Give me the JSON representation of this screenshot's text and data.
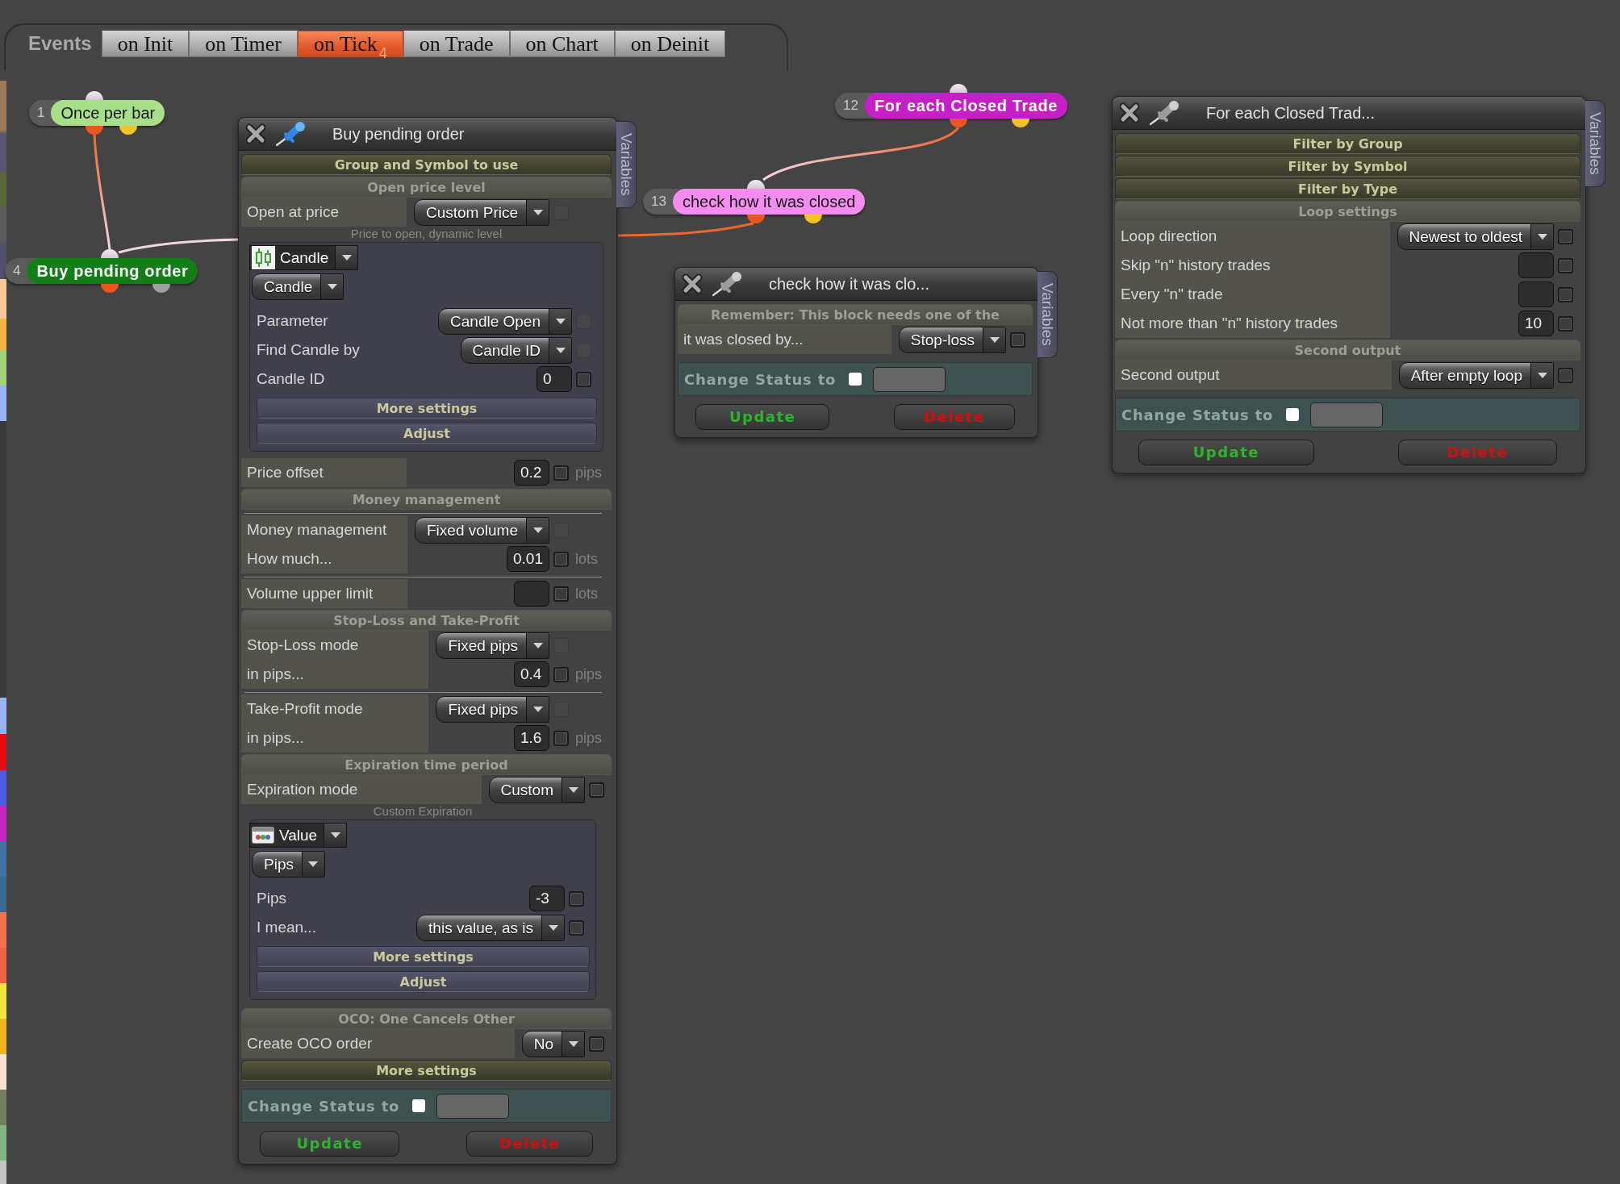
{
  "events_bar": {
    "label": "Events",
    "tabs": [
      {
        "label": "on Init",
        "selected": false
      },
      {
        "label": "on Timer",
        "selected": false
      },
      {
        "label": "on Tick",
        "selected": true,
        "count": "4"
      },
      {
        "label": "on Trade",
        "selected": false
      },
      {
        "label": "on Chart",
        "selected": false
      },
      {
        "label": "on Deinit",
        "selected": false
      }
    ]
  },
  "nodes": [
    {
      "number": "1",
      "label": "Once per bar",
      "color": "#a8df8a",
      "outputs": [
        {
          "color": "#ea561f"
        },
        {
          "color": "#f1c22c"
        }
      ]
    },
    {
      "number": "4",
      "label": "Buy pending order",
      "color": "#117e17",
      "outputs": [
        {
          "color": "#ea561f"
        },
        {
          "color": "#a0a0a0"
        }
      ]
    },
    {
      "number": "12",
      "label": "For each Closed Trade",
      "color": "#c81ec8",
      "outputs": [
        {
          "color": "#ea561f"
        },
        {
          "color": "#f1c22c"
        }
      ]
    },
    {
      "number": "13",
      "label": "check how it was closed",
      "color": "#f58df0",
      "outputs": [
        {
          "color": "#ea561f"
        },
        {
          "color": "#f1c22c"
        }
      ]
    }
  ],
  "panels": [
    {
      "title": "Buy pending order",
      "pinned": true,
      "side_tab": "Variables",
      "items": [
        {
          "kind": "section",
          "title": "Group and Symbol to use",
          "expanded": false
        },
        {
          "kind": "section",
          "title": "Open price level",
          "expanded": true,
          "items": [
            {
              "kind": "field",
              "label": "Open at price",
              "control": {
                "kind": "dropdown",
                "value": "Custom Price"
              },
              "checkbox": {
                "checked": false,
                "disabled": true
              }
            },
            {
              "kind": "hint",
              "text": "Price to open, dynamic level"
            },
            {
              "kind": "subpanel",
              "items": [
                {
                  "kind": "candle_source",
                  "value": "Candle"
                },
                {
                  "kind": "dropdown",
                  "value": "Candle"
                },
                {
                  "kind": "field",
                  "label": "Parameter",
                  "control": {
                    "kind": "dropdown",
                    "value": "Candle Open"
                  },
                  "checkbox": {
                    "checked": false,
                    "disabled": true
                  }
                },
                {
                  "kind": "field",
                  "label": "Find Candle by",
                  "control": {
                    "kind": "dropdown",
                    "value": "Candle ID"
                  },
                  "checkbox": {
                    "checked": false,
                    "disabled": true
                  }
                },
                {
                  "kind": "field",
                  "label": "Candle ID",
                  "control": {
                    "kind": "input",
                    "value": "0"
                  },
                  "checkbox": {
                    "checked": false,
                    "disabled": false
                  }
                },
                {
                  "kind": "section",
                  "title": "More settings",
                  "expanded": false
                },
                {
                  "kind": "section",
                  "title": "Adjust",
                  "expanded": false
                }
              ]
            },
            {
              "kind": "field",
              "label": "Price offset",
              "control": {
                "kind": "input",
                "value": "0.2"
              },
              "checkbox": {
                "checked": false,
                "disabled": false
              },
              "unit": "pips"
            }
          ]
        },
        {
          "kind": "section",
          "title": "Money management",
          "expanded": true,
          "items": [
            {
              "kind": "divider"
            },
            {
              "kind": "field",
              "label": "Money management",
              "control": {
                "kind": "dropdown",
                "value": "Fixed volume"
              },
              "checkbox": {
                "checked": false,
                "disabled": true
              }
            },
            {
              "kind": "field",
              "label": "How much...",
              "control": {
                "kind": "input",
                "value": "0.01"
              },
              "checkbox": {
                "checked": false,
                "disabled": false
              },
              "unit": "lots"
            },
            {
              "kind": "divider"
            },
            {
              "kind": "field",
              "label": "Volume upper limit",
              "control": {
                "kind": "input"
              },
              "checkbox": {
                "checked": false,
                "disabled": false
              },
              "unit": "lots"
            }
          ]
        },
        {
          "kind": "section",
          "title": "Stop-Loss and Take-Profit",
          "expanded": true,
          "items": [
            {
              "kind": "field",
              "label": "Stop-Loss mode",
              "control": {
                "kind": "dropdown",
                "value": "Fixed pips"
              },
              "checkbox": {
                "checked": false,
                "disabled": true
              }
            },
            {
              "kind": "field",
              "label": "in pips...",
              "control": {
                "kind": "input",
                "value": "0.4"
              },
              "checkbox": {
                "checked": false,
                "disabled": false
              },
              "unit": "pips"
            },
            {
              "kind": "divider"
            },
            {
              "kind": "field",
              "label": "Take-Profit mode",
              "control": {
                "kind": "dropdown",
                "value": "Fixed pips"
              },
              "checkbox": {
                "checked": false,
                "disabled": true
              }
            },
            {
              "kind": "field",
              "label": "in pips...",
              "control": {
                "kind": "input",
                "value": "1.6"
              },
              "checkbox": {
                "checked": false,
                "disabled": false
              },
              "unit": "pips"
            }
          ]
        },
        {
          "kind": "section",
          "title": "Expiration time period",
          "expanded": true,
          "items": [
            {
              "kind": "field",
              "label": "Expiration mode",
              "control": {
                "kind": "dropdown",
                "value": "Custom"
              },
              "checkbox": {
                "checked": false,
                "disabled": false
              }
            },
            {
              "kind": "hint",
              "text": "Custom Expiration"
            },
            {
              "kind": "subpanel",
              "items": [
                {
                  "kind": "value_source",
                  "value": "Value"
                },
                {
                  "kind": "dropdown",
                  "value": "Pips"
                },
                {
                  "kind": "field",
                  "label": "Pips",
                  "control": {
                    "kind": "input",
                    "value": "-3"
                  },
                  "checkbox": {
                    "checked": false,
                    "disabled": false
                  }
                },
                {
                  "kind": "field",
                  "label": "I mean...",
                  "control": {
                    "kind": "dropdown",
                    "value": "this value, as is"
                  },
                  "checkbox": {
                    "checked": false,
                    "disabled": false
                  }
                },
                {
                  "kind": "section",
                  "title": "More settings",
                  "expanded": false
                },
                {
                  "kind": "section",
                  "title": "Adjust",
                  "expanded": false
                }
              ]
            }
          ]
        },
        {
          "kind": "section",
          "title": "OCO: One Cancels Other",
          "expanded": true,
          "items": [
            {
              "kind": "field",
              "label": "Create OCO order",
              "control": {
                "kind": "dropdown",
                "value": "No"
              },
              "checkbox": {
                "checked": false,
                "disabled": false
              }
            }
          ]
        },
        {
          "kind": "section",
          "title": "More settings",
          "expanded": false
        }
      ],
      "status": {
        "label": "Change Status to",
        "checked": false
      },
      "buttons": [
        {
          "label": "Update",
          "kind": "update"
        },
        {
          "label": "Delete",
          "kind": "delete"
        }
      ]
    },
    {
      "title": "check how it was clo...",
      "pinned": false,
      "side_tab": "Variables",
      "items": [
        {
          "kind": "section",
          "title": "Remember: This block needs one of the",
          "expanded": true,
          "items": [
            {
              "kind": "field",
              "label": "it was closed by...",
              "control": {
                "kind": "dropdown",
                "value": "Stop-loss"
              },
              "checkbox": {
                "checked": false,
                "disabled": false
              }
            }
          ]
        }
      ],
      "status": {
        "label": "Change Status to",
        "checked": false
      },
      "buttons": [
        {
          "label": "Update",
          "kind": "update"
        },
        {
          "label": "Delete",
          "kind": "delete"
        }
      ]
    },
    {
      "title": "For each Closed Trad...",
      "pinned": false,
      "side_tab": "Variables",
      "items": [
        {
          "kind": "section",
          "title": "Filter by Group",
          "expanded": false
        },
        {
          "kind": "section",
          "title": "Filter by Symbol",
          "expanded": false
        },
        {
          "kind": "section",
          "title": "Filter by Type",
          "expanded": false
        },
        {
          "kind": "section",
          "title": "Loop settings",
          "expanded": true,
          "items": [
            {
              "kind": "field",
              "label": "Loop direction",
              "control": {
                "kind": "dropdown",
                "value": "Newest to oldest"
              },
              "checkbox": {
                "checked": false,
                "disabled": false
              }
            },
            {
              "kind": "field",
              "label": "Skip \"n\" history trades",
              "control": {
                "kind": "input"
              },
              "checkbox": {
                "checked": false,
                "disabled": false
              }
            },
            {
              "kind": "field",
              "label": "Every \"n\" trade",
              "control": {
                "kind": "input"
              },
              "checkbox": {
                "checked": false,
                "disabled": false
              }
            },
            {
              "kind": "field",
              "label": "Not more than \"n\" history trades",
              "control": {
                "kind": "input",
                "value": "10"
              },
              "checkbox": {
                "checked": false,
                "disabled": false
              }
            }
          ]
        },
        {
          "kind": "section",
          "title": "Second output",
          "expanded": true,
          "items": [
            {
              "kind": "field",
              "label": "Second output",
              "control": {
                "kind": "dropdown",
                "value": "After empty loop"
              },
              "checkbox": {
                "checked": false,
                "disabled": false
              }
            }
          ]
        }
      ],
      "status": {
        "label": "Change Status to",
        "checked": false
      },
      "buttons": [
        {
          "label": "Update",
          "kind": "update"
        },
        {
          "label": "Delete",
          "kind": "delete"
        }
      ]
    }
  ]
}
